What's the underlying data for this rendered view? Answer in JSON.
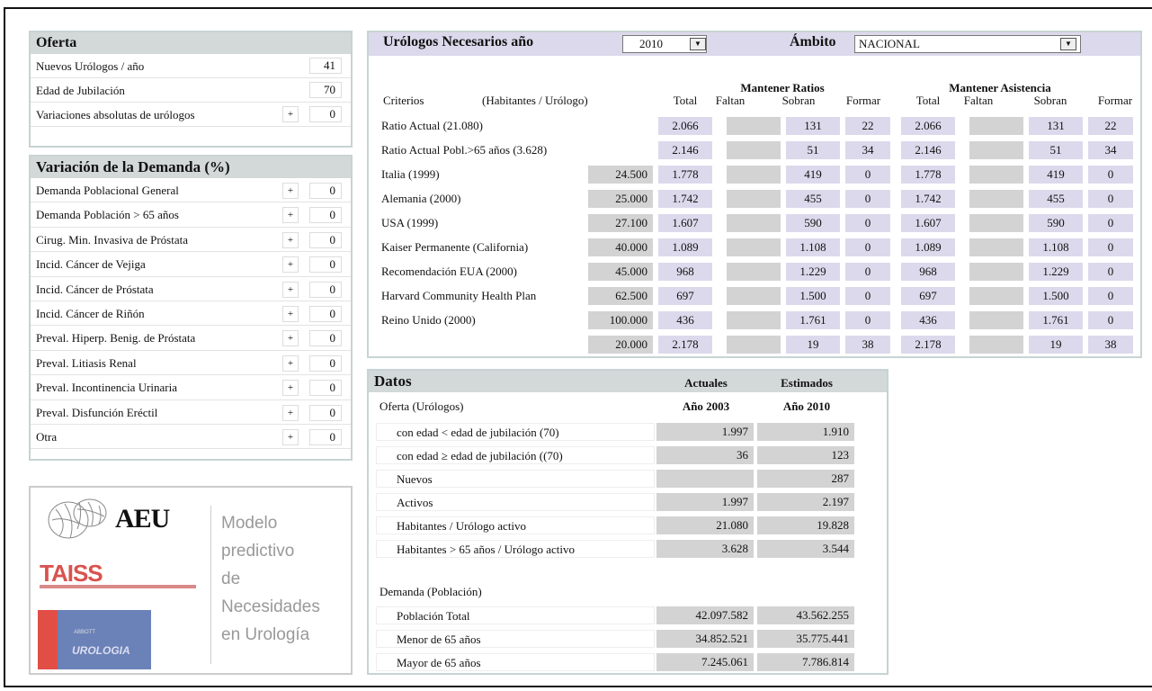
{
  "oferta": {
    "title": "Oferta",
    "rows": [
      {
        "label": "Nuevos Urólogos / año",
        "value": "41"
      },
      {
        "label": "Edad de Jubilación",
        "value": "70"
      },
      {
        "label": "Variaciones absolutas de urólogos",
        "plus": "+",
        "value": "0"
      }
    ]
  },
  "demanda": {
    "title": "Variación de la Demanda (%)",
    "plus": "+",
    "rows": [
      {
        "label": "Demanda Poblacional General",
        "value": "0"
      },
      {
        "label": "Demanda Población > 65 años",
        "value": "0"
      },
      {
        "label": "Cirug. Min. Invasiva de Próstata",
        "value": "0"
      },
      {
        "label": "Incid. Cáncer de Vejiga",
        "value": "0"
      },
      {
        "label": "Incid. Cáncer de Próstata",
        "value": "0"
      },
      {
        "label": "Incid. Cáncer de Riñón",
        "value": "0"
      },
      {
        "label": "Preval. Hiperp. Benig. de Próstata",
        "value": "0"
      },
      {
        "label": "Preval. Litiasis Renal",
        "value": "0"
      },
      {
        "label": "Preval. Incontinencia Urinaria",
        "value": "0"
      },
      {
        "label": "Preval. Disfunción Eréctil",
        "value": "0"
      },
      {
        "label": "Otra",
        "value": "0"
      }
    ]
  },
  "logo": {
    "aeu": "AEU",
    "taiss": "TAISS",
    "abbott": "ABBOTT",
    "urologia": "UROLOGIA",
    "model_lines": [
      "Modelo",
      "predictivo",
      "de",
      "Necesidades",
      "en Urología"
    ]
  },
  "necesarios": {
    "title": "Urólogos Necesarios año",
    "year": "2010",
    "ambito_label": "Ámbito",
    "ambito_value": "NACIONAL",
    "group1": "Mantener Ratios",
    "group2": "Mantener Asistencia",
    "criterios": "Criterios",
    "hab_uro": "(Habitantes / Urólogo)",
    "cols": [
      "Total",
      "Faltan",
      "Sobran",
      "Formar"
    ],
    "rows": [
      {
        "label": "Ratio Actual (21.080)",
        "hab": "",
        "r_total": "2.066",
        "r_faltan": "",
        "r_sobran": "131",
        "r_formar": "22",
        "a_total": "2.066",
        "a_faltan": "",
        "a_sobran": "131",
        "a_formar": "22"
      },
      {
        "label": "Ratio Actual Pobl.>65 años (3.628)",
        "hab": "",
        "r_total": "2.146",
        "r_faltan": "",
        "r_sobran": "51",
        "r_formar": "34",
        "a_total": "2.146",
        "a_faltan": "",
        "a_sobran": "51",
        "a_formar": "34"
      },
      {
        "label": "Italia (1999)",
        "hab": "24.500",
        "r_total": "1.778",
        "r_faltan": "",
        "r_sobran": "419",
        "r_formar": "0",
        "a_total": "1.778",
        "a_faltan": "",
        "a_sobran": "419",
        "a_formar": "0"
      },
      {
        "label": "Alemania (2000)",
        "hab": "25.000",
        "r_total": "1.742",
        "r_faltan": "",
        "r_sobran": "455",
        "r_formar": "0",
        "a_total": "1.742",
        "a_faltan": "",
        "a_sobran": "455",
        "a_formar": "0"
      },
      {
        "label": "USA (1999)",
        "hab": "27.100",
        "r_total": "1.607",
        "r_faltan": "",
        "r_sobran": "590",
        "r_formar": "0",
        "a_total": "1.607",
        "a_faltan": "",
        "a_sobran": "590",
        "a_formar": "0"
      },
      {
        "label": "Kaiser Permanente (California)",
        "hab": "40.000",
        "r_total": "1.089",
        "r_faltan": "",
        "r_sobran": "1.108",
        "r_formar": "0",
        "a_total": "1.089",
        "a_faltan": "",
        "a_sobran": "1.108",
        "a_formar": "0"
      },
      {
        "label": "Recomendación EUA (2000)",
        "hab": "45.000",
        "r_total": "968",
        "r_faltan": "",
        "r_sobran": "1.229",
        "r_formar": "0",
        "a_total": "968",
        "a_faltan": "",
        "a_sobran": "1.229",
        "a_formar": "0"
      },
      {
        "label": "Harvard Community Health Plan",
        "hab": "62.500",
        "r_total": "697",
        "r_faltan": "",
        "r_sobran": "1.500",
        "r_formar": "0",
        "a_total": "697",
        "a_faltan": "",
        "a_sobran": "1.500",
        "a_formar": "0"
      },
      {
        "label": "Reino Unido (2000)",
        "hab": "100.000",
        "r_total": "436",
        "r_faltan": "",
        "r_sobran": "1.761",
        "r_formar": "0",
        "a_total": "436",
        "a_faltan": "",
        "a_sobran": "1.761",
        "a_formar": "0"
      },
      {
        "label": "",
        "hab": "20.000",
        "r_total": "2.178",
        "r_faltan": "",
        "r_sobran": "19",
        "r_formar": "38",
        "a_total": "2.178",
        "a_faltan": "",
        "a_sobran": "19",
        "a_formar": "38"
      }
    ]
  },
  "datos": {
    "title": "Datos",
    "col1": "Actuales",
    "col2": "Estimados",
    "oferta_label": "Oferta (Urólogos)",
    "year1": "Año 2003",
    "year2": "Año 2010",
    "oferta_rows": [
      {
        "label": "con edad < edad de jubilación (70)",
        "v1": "1.997",
        "v2": "1.910"
      },
      {
        "label": "con edad ≥ edad de jubilación ((70)",
        "v1": "36",
        "v2": "123"
      },
      {
        "label": "Nuevos",
        "v1": "",
        "v2": "287"
      },
      {
        "label": "Activos",
        "v1": "1.997",
        "v2": "2.197"
      },
      {
        "label": "Habitantes / Urólogo activo",
        "v1": "21.080",
        "v2": "19.828"
      },
      {
        "label": "Habitantes > 65 años / Urólogo activo",
        "v1": "3.628",
        "v2": "3.544"
      }
    ],
    "demanda_label": "Demanda (Población)",
    "demanda_rows": [
      {
        "label": "Población Total",
        "v1": "42.097.582",
        "v2": "43.562.255"
      },
      {
        "label": "Menor de 65 años",
        "v1": "34.852.521",
        "v2": "35.775.441"
      },
      {
        "label": "Mayor de 65 años",
        "v1": "7.245.061",
        "v2": "7.786.814"
      }
    ]
  }
}
